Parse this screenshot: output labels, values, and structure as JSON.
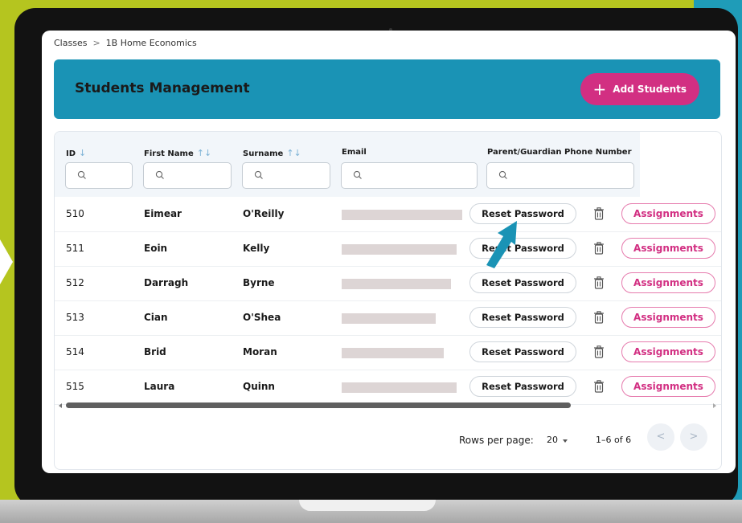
{
  "breadcrumb": {
    "root": "Classes",
    "separator": ">",
    "current": "1B Home Economics"
  },
  "banner": {
    "title": "Students Management",
    "add_button": "Add Students",
    "add_icon": "plus-icon"
  },
  "table": {
    "columns": [
      {
        "key": "id",
        "label": "ID",
        "sort": "↓"
      },
      {
        "key": "first",
        "label": "First Name",
        "sort": "↑↓"
      },
      {
        "key": "surname",
        "label": "Surname",
        "sort": "↑↓"
      },
      {
        "key": "email",
        "label": "Email",
        "sort": ""
      },
      {
        "key": "phone",
        "label": "Parent/Guardian Phone Number",
        "sort": ""
      }
    ],
    "reset_label": "Reset Password",
    "assign_label": "Assignments",
    "rows": [
      {
        "id": "510",
        "first": "Eimear",
        "surname": "O'Reilly"
      },
      {
        "id": "511",
        "first": "Eoin",
        "surname": "Kelly"
      },
      {
        "id": "512",
        "first": "Darragh",
        "surname": "Byrne"
      },
      {
        "id": "513",
        "first": "Cian",
        "surname": "O'Shea"
      },
      {
        "id": "514",
        "first": "Brid",
        "surname": "Moran"
      },
      {
        "id": "515",
        "first": "Laura",
        "surname": "Quinn"
      }
    ]
  },
  "pagination": {
    "rows_label": "Rows per page:",
    "rows_value": "20",
    "range": "1–6 of 6",
    "prev": "<",
    "next": ">"
  },
  "colors": {
    "banner": "#1a93b5",
    "accent": "#d22f82",
    "background": "#b5c51f"
  }
}
